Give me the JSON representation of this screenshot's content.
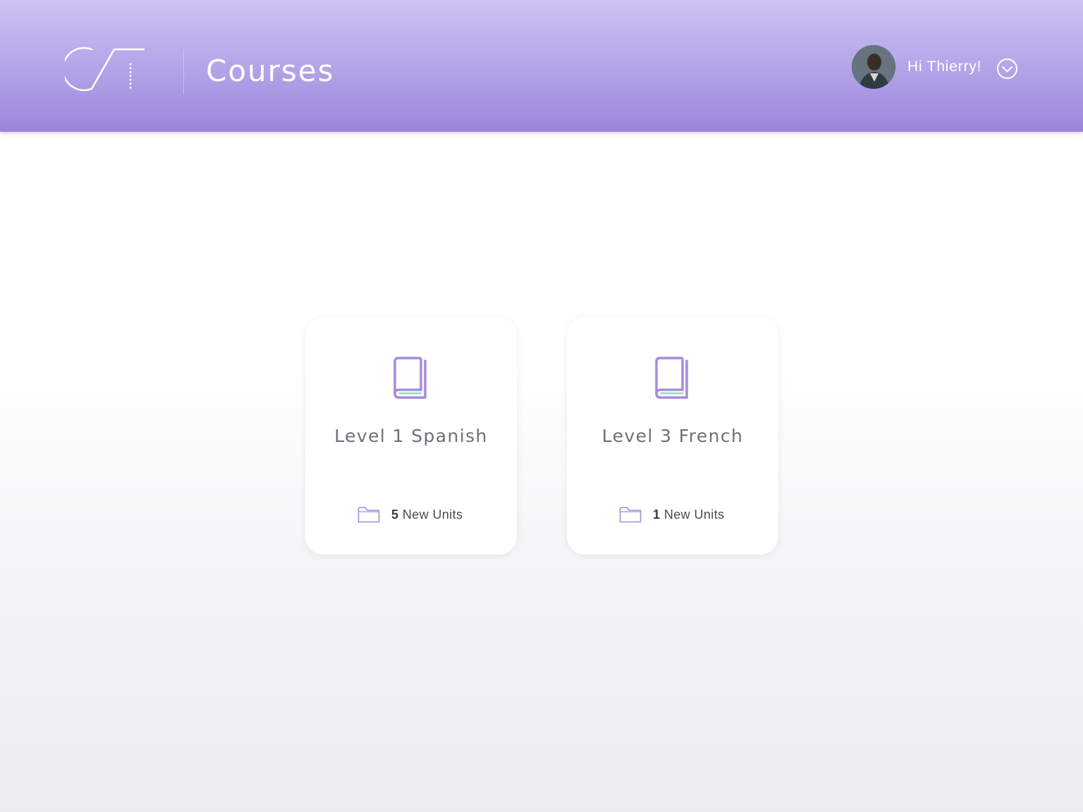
{
  "header": {
    "title": "Courses",
    "greeting": "Hi Thierry!",
    "logo_icon": "ct-logo-icon",
    "menu_icon": "chevron-down-circle-icon"
  },
  "courses": [
    {
      "title": "Level 1 Spanish",
      "units_count": "5",
      "units_label": "New Units",
      "icon": "book-icon"
    },
    {
      "title": "Level 3 French",
      "units_count": "1",
      "units_label": "New Units",
      "icon": "book-icon"
    }
  ],
  "colors": {
    "header_top": "#cdc3f2",
    "header_bottom": "#9c85da",
    "accent": "#a58be0",
    "accent_green": "#9fe0c6"
  }
}
